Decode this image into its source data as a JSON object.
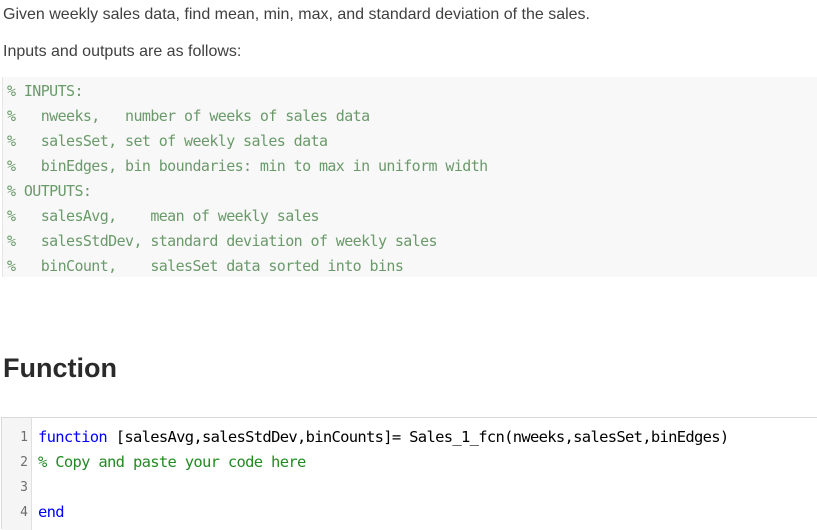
{
  "intro": {
    "paragraph1": "Given weekly sales data, find mean, min, max, and standard deviation of the sales.",
    "paragraph2": "Inputs and outputs are as follows:"
  },
  "comment_block": {
    "lines": [
      "% INPUTS:",
      "%   nweeks,   number of weeks of sales data",
      "%   salesSet, set of weekly sales data",
      "%   binEdges, bin boundaries: min to max in uniform width",
      "% OUTPUTS:",
      "%   salesAvg,    mean of weekly sales",
      "%   salesStdDev, standard deviation of weekly sales",
      "%   binCount,    salesSet data sorted into bins"
    ]
  },
  "section": {
    "title": "Function"
  },
  "editor": {
    "lines": [
      {
        "number": "1",
        "keyword": "function",
        "text": " [salesAvg,salesStdDev,binCounts]= Sales_1_fcn(nweeks,salesSet,binEdges)"
      },
      {
        "number": "2",
        "comment": "% Copy and paste your code here"
      },
      {
        "number": "3",
        "text": ""
      },
      {
        "number": "4",
        "keyword": "end"
      }
    ],
    "colors": {
      "keyword": "#0000ff",
      "comment": "#228b22",
      "text": "#000000"
    }
  }
}
